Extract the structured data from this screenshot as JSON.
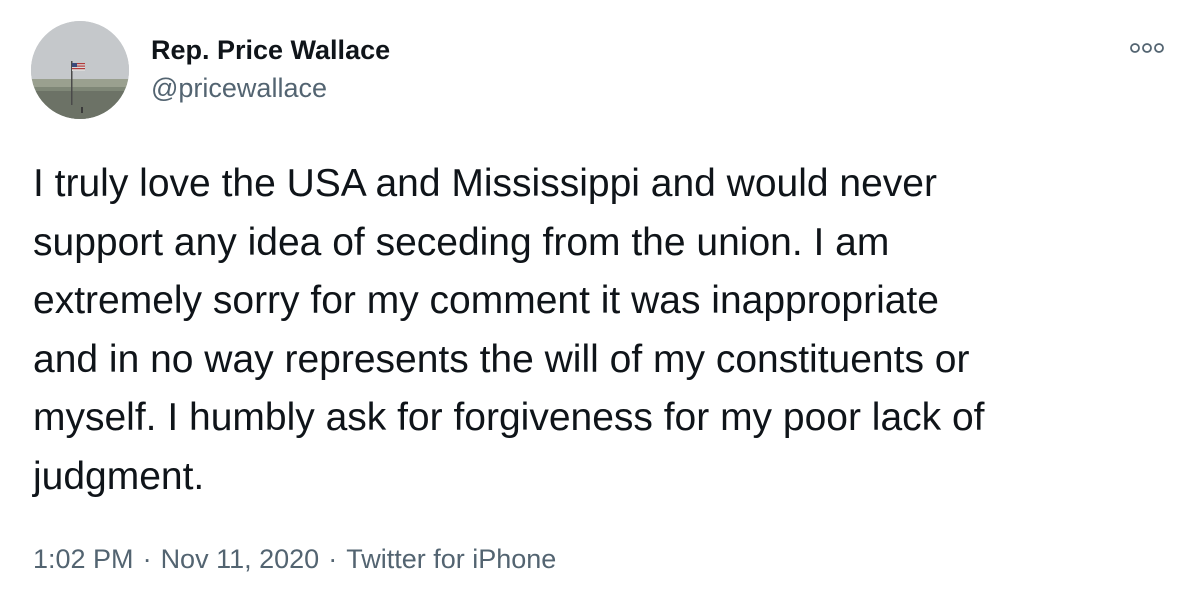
{
  "author": {
    "display_name": "Rep. Price Wallace",
    "handle": "@pricewallace",
    "avatar_description": "avatar-photo-flag"
  },
  "menu": {
    "icon": "more-options-icon"
  },
  "tweet": {
    "lines": [
      "I truly love the USA and Mississippi and would never",
      "support any idea of seceding from the union. I am",
      "extremely sorry for my comment it was inappropriate",
      "and in no way represents the will of my constituents or",
      "myself. I humbly ask for forgiveness for my poor lack of",
      "judgment."
    ]
  },
  "meta": {
    "time": "1:02 PM",
    "date": "Nov 11, 2020",
    "source": "Twitter for iPhone",
    "separator": "·"
  },
  "colors": {
    "text_primary": "#0f1419",
    "text_secondary": "#536471",
    "background": "#ffffff"
  }
}
